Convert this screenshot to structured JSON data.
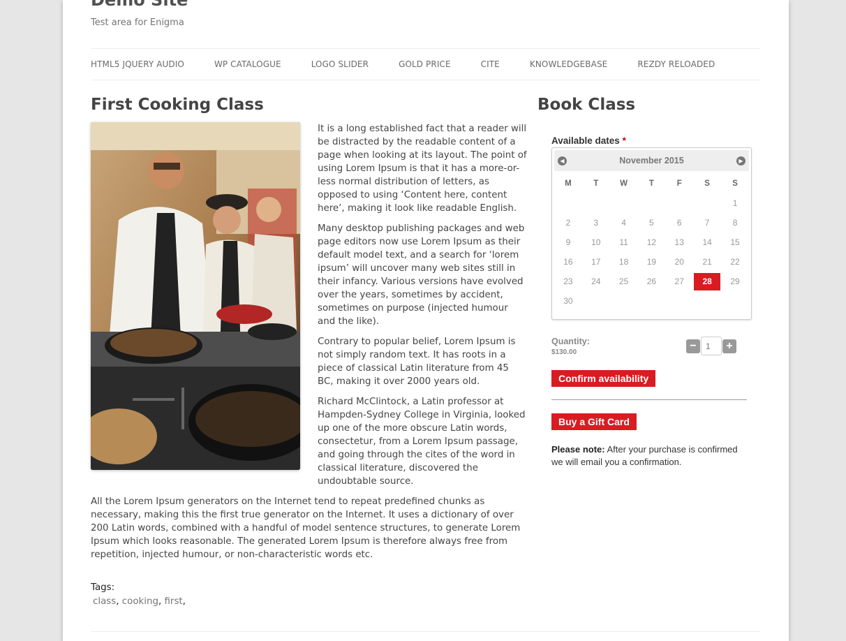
{
  "site": {
    "title": "Demo Site",
    "tagline": "Test area for Enigma"
  },
  "nav": {
    "items": [
      "HTML5 JQUERY AUDIO",
      "WP CATALOGUE",
      "LOGO SLIDER",
      "GOLD PRICE",
      "CITE",
      "KNOWLEDGEBASE",
      "REZDY RELOADED"
    ]
  },
  "post": {
    "title": "First Cooking Class",
    "paragraphs": [
      "It is a long established fact that a reader will be distracted by the readable content of a page when looking at its layout. The point of using Lorem Ipsum is that it has a more-or-less normal distribution of letters, as opposed to using ‘Content here, content here’, making it look like readable English.",
      "Many desktop publishing packages and web page editors now use Lorem Ipsum as their default model text, and a search for ‘lorem ipsum’ will uncover many web sites still in their infancy. Various versions have evolved over the years, sometimes by accident, sometimes on purpose (injected humour and the like).",
      "Contrary to popular belief, Lorem Ipsum is not simply random text. It has roots in a piece of classical Latin literature from 45 BC, making it over 2000 years old.",
      "Richard McClintock, a Latin professor at Hampden-Sydney College in Virginia, looked up one of the more obscure Latin words, consectetur, from a Lorem Ipsum passage, and going through the cites of the word in classical literature, discovered the undoubtable source.",
      "All the Lorem Ipsum generators on the Internet tend to repeat predefined chunks as necessary, making this the first true generator on the Internet. It uses a dictionary of over 200 Latin words, combined with a handful of model sentence structures, to generate Lorem Ipsum which looks reasonable. The generated Lorem Ipsum is therefore always free from repetition, injected humour, or non-characteristic words etc."
    ],
    "tags_label": "Tags:",
    "tags": [
      "class",
      "cooking",
      "first"
    ]
  },
  "booking": {
    "title": "Book Class",
    "dates_label": "Available dates",
    "required_mark": "*",
    "calendar": {
      "month": "November 2015",
      "weekdays": [
        "M",
        "T",
        "W",
        "T",
        "F",
        "S",
        "S"
      ],
      "weeks": [
        [
          "",
          "",
          "",
          "",
          "",
          "",
          "1"
        ],
        [
          "2",
          "3",
          "4",
          "5",
          "6",
          "7",
          "8"
        ],
        [
          "9",
          "10",
          "11",
          "12",
          "13",
          "14",
          "15"
        ],
        [
          "16",
          "17",
          "18",
          "19",
          "20",
          "21",
          "22"
        ],
        [
          "23",
          "24",
          "25",
          "26",
          "27",
          "28",
          "29"
        ],
        [
          "30",
          "",
          "",
          "",
          "",
          "",
          ""
        ]
      ],
      "selected": "28",
      "prev_icon": "arrow-left-icon",
      "next_icon": "arrow-right-icon"
    },
    "quantity_label": "Quantity:",
    "price": "$130.00",
    "quantity_value": "1",
    "confirm_label": "Confirm availability",
    "gift_label": "Buy a Gift Card",
    "note_bold": "Please note:",
    "note_text": "After your purchase is confirmed we will email you a confirmation.",
    "accent_color": "#d81c22"
  }
}
